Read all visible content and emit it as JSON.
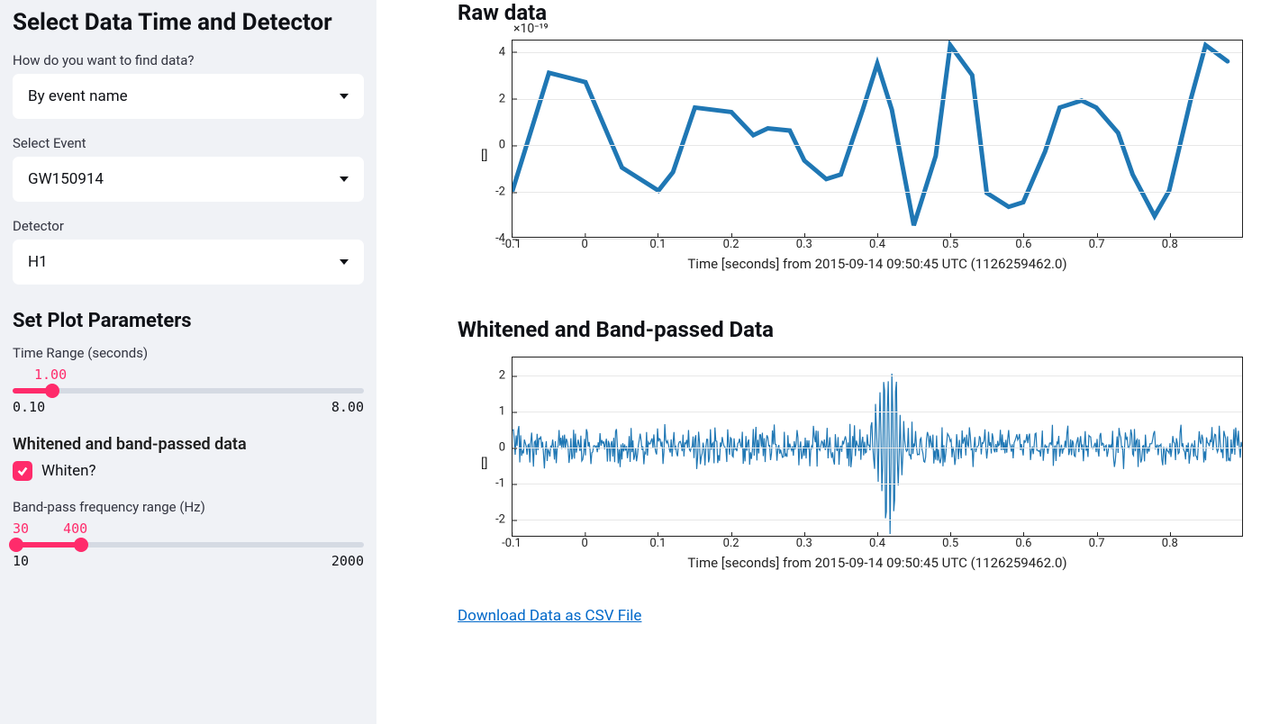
{
  "sidebar": {
    "heading_time_detector": "Select Data Time and Detector",
    "find_data_label": "How do you want to find data?",
    "find_data_value": "By event name",
    "select_event_label": "Select Event",
    "select_event_value": "GW150914",
    "detector_label": "Detector",
    "detector_value": "H1",
    "heading_plot_params": "Set Plot Parameters",
    "time_range_label": "Time Range (seconds)",
    "time_range_value": "1.00",
    "time_range_min": "0.10",
    "time_range_max": "8.00",
    "whiten_section": "Whitened and band-passed data",
    "whiten_checkbox_label": "Whiten?",
    "whiten_checked": true,
    "bandpass_label": "Band-pass frequency range (Hz)",
    "bandpass_low": "30",
    "bandpass_high": "400",
    "bandpass_min": "10",
    "bandpass_max": "2000"
  },
  "main": {
    "raw_title": "Raw data",
    "raw_sci": "×10⁻¹⁹",
    "y_unit": "[]",
    "xlabel": "Time [seconds] from 2015-09-14 09:50:45 UTC (1126259462.0)",
    "raw_y_ticks": [
      "4",
      "2",
      "0",
      "-2",
      "-4"
    ],
    "x_ticks": [
      "-0.1",
      "0",
      "0.1",
      "0.2",
      "0.3",
      "0.4",
      "0.5",
      "0.6",
      "0.7",
      "0.8"
    ],
    "white_title": "Whitened and Band-passed Data",
    "white_y_ticks": [
      "2",
      "1",
      "0",
      "-1",
      "-2"
    ],
    "download_label": "Download Data as CSV File"
  },
  "chart_data": [
    {
      "type": "line",
      "title": "Raw data",
      "xlabel": "Time [seconds] from 2015-09-14 09:50:45 UTC (1126259462.0)",
      "ylabel": "[]",
      "y_scale": "×10⁻¹⁹",
      "xlim": [
        -0.1,
        0.9
      ],
      "ylim": [
        -4,
        4.5
      ],
      "x": [
        -0.1,
        -0.05,
        0.0,
        0.05,
        0.1,
        0.12,
        0.15,
        0.2,
        0.23,
        0.25,
        0.28,
        0.3,
        0.33,
        0.35,
        0.38,
        0.4,
        0.42,
        0.45,
        0.48,
        0.5,
        0.53,
        0.55,
        0.58,
        0.6,
        0.63,
        0.65,
        0.68,
        0.7,
        0.73,
        0.75,
        0.78,
        0.8,
        0.83,
        0.85,
        0.88
      ],
      "values": [
        -2.0,
        3.1,
        2.7,
        -1.0,
        -2.0,
        -1.2,
        1.6,
        1.4,
        0.4,
        0.7,
        0.6,
        -0.7,
        -1.5,
        -1.3,
        1.5,
        3.5,
        1.5,
        -3.5,
        -0.5,
        4.3,
        3.0,
        -2.1,
        -2.7,
        -2.5,
        -0.3,
        1.6,
        1.9,
        1.6,
        0.5,
        -1.3,
        -3.1,
        -2.0,
        2.0,
        4.3,
        3.6
      ]
    },
    {
      "type": "line",
      "title": "Whitened and Band-passed Data",
      "xlabel": "Time [seconds] from 2015-09-14 09:50:45 UTC (1126259462.0)",
      "ylabel": "[]",
      "xlim": [
        -0.1,
        0.9
      ],
      "ylim": [
        -2.5,
        2.5
      ],
      "note": "noisy whitened strain; amplitude roughly ±0.6 except burst near t≈0.40–0.43 reaching about +2.5 / -2.4"
    }
  ]
}
